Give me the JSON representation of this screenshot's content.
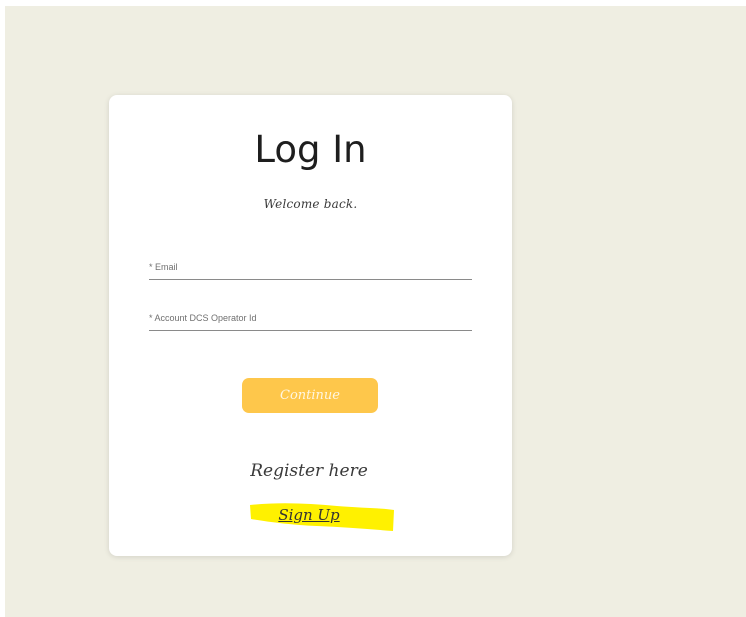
{
  "login": {
    "title": "Log In",
    "subtitle": "Welcome back.",
    "email_placeholder": "* Email",
    "operator_placeholder": "* Account DCS Operator Id",
    "continue_label": "Continue",
    "register_text": "Register here",
    "signup_label": "Sign Up"
  },
  "colors": {
    "page_background": "#efeee2",
    "card_background": "#ffffff",
    "button_accent": "#fec74b",
    "highlight": "#fff100"
  }
}
